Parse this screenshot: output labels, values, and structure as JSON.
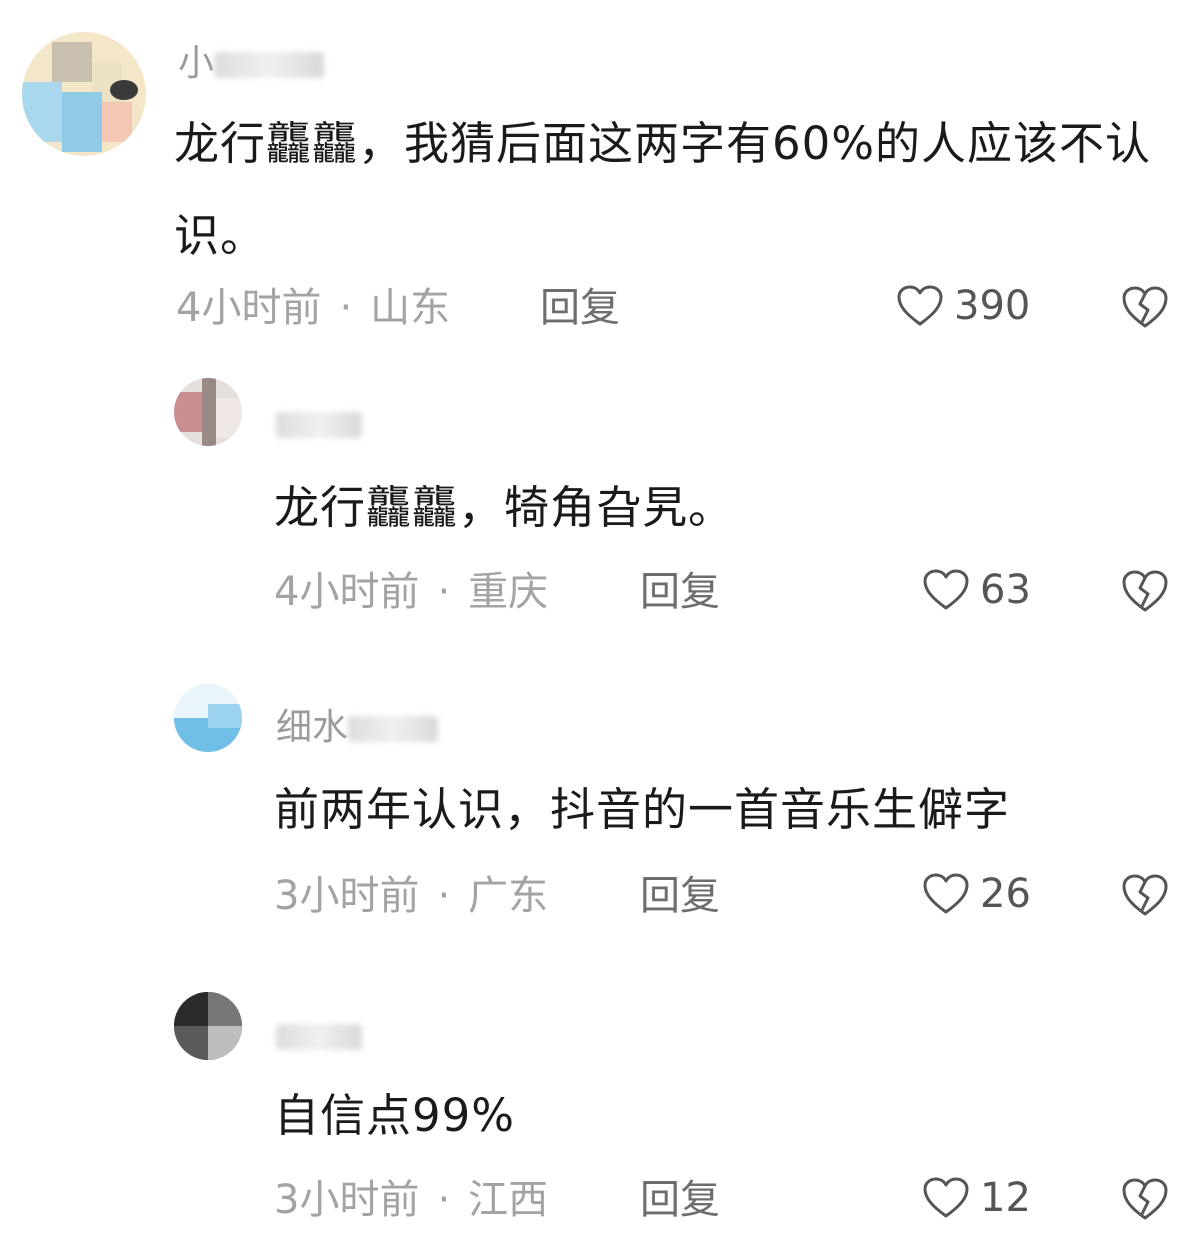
{
  "comments": [
    {
      "username": "小",
      "content": "龙行龘龘，我猜后面这两字有60%的人应该不认识。",
      "time": "4小时前",
      "region": "山东",
      "reply_label": "回复",
      "likes": "390",
      "like_icon": "heart-outline-icon",
      "dislike_icon": "broken-heart-icon"
    },
    {
      "username": "",
      "content": "龙行龘龘，犄角旮旯。",
      "time": "4小时前",
      "region": "重庆",
      "reply_label": "回复",
      "likes": "63"
    },
    {
      "username": "细水",
      "content": "前两年认识，抖音的一首音乐生僻字",
      "time": "3小时前",
      "region": "广东",
      "reply_label": "回复",
      "likes": "26"
    },
    {
      "username": "",
      "content": "自信点99%",
      "time": "3小时前",
      "region": "江西",
      "reply_label": "回复",
      "likes": "12"
    }
  ],
  "meta_separator": "·",
  "colors": {
    "text": "#1a1a1a",
    "meta": "#a3a3a3",
    "icon": "#555555"
  }
}
